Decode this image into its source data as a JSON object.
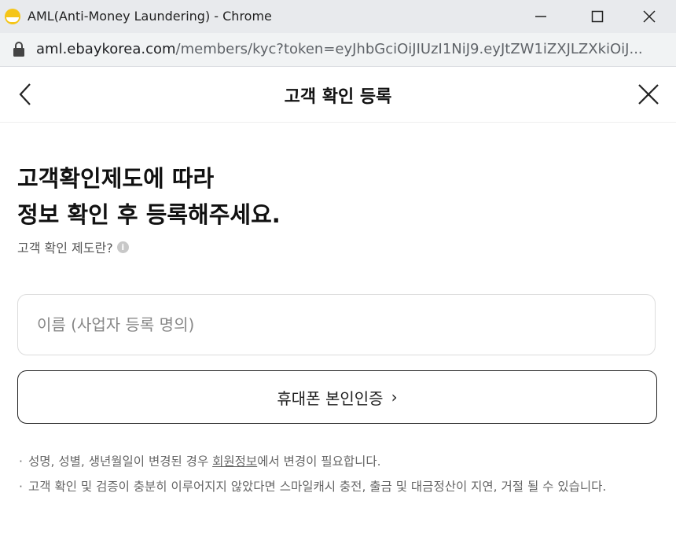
{
  "window": {
    "title": "AML(Anti-Money Laundering) - Chrome"
  },
  "address_bar": {
    "domain": "aml.ebaykorea.com",
    "path": "/members/kyc?token=eyJhbGciOiJIUzI1NiJ9.eyJtZW1iZXJLZXkiOiJ..."
  },
  "header": {
    "title": "고객 확인 등록"
  },
  "main": {
    "heading_line1": "고객확인제도에 따라",
    "heading_line2": "정보 확인 후 등록해주세요.",
    "kyc_info_link": "고객 확인 제도란?",
    "info_icon": "i",
    "name_placeholder": "이름 (사업자 등록 명의)",
    "verify_button_label": "휴대폰 본인인증",
    "verify_button_chevron": "›"
  },
  "notes": {
    "bullet": "·",
    "note1_before": "성명, 성별, 생년월일이 변경된 경우 ",
    "note1_link": "회원정보",
    "note1_after": "에서 변경이 필요합니다.",
    "note2": "고객 확인 및 검증이 충분히 이루어지지 않았다면 스마일캐시 충전, 출금 및 대금정산이 지연, 거절 될 수 있습니다."
  },
  "icons": {
    "app": "ebay-smile-icon",
    "minimize": "minimize-icon",
    "maximize": "maximize-icon",
    "close_window": "close-window-icon",
    "lock": "lock-icon",
    "back": "chevron-left-icon",
    "close": "close-icon"
  },
  "colors": {
    "titlebar": "#e8eaed",
    "brand_yellow": "#f5c518"
  }
}
